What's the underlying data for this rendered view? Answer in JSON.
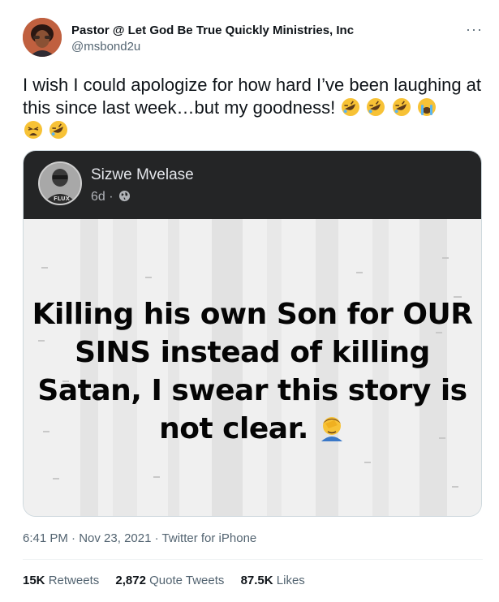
{
  "author": {
    "display_name": "Pastor @ Let God Be True Quickly Ministries, Inc",
    "handle": "@msbond2u",
    "avatar_icon": "profile-photo"
  },
  "more_icon": "more-options-icon",
  "tweet": {
    "text": "I wish I could apologize for how hard I’ve been laughing at this since last week…but my goodness!",
    "emojis": [
      "rolling-on-floor-laughing",
      "rolling-on-floor-laughing",
      "rolling-on-floor-laughing",
      "loudly-crying-face",
      "weary-face",
      "rolling-on-floor-laughing"
    ]
  },
  "embedded_post": {
    "poster_name": "Sizwe Mvelase",
    "age": "6d",
    "separator": "·",
    "visibility_icon": "globe-icon",
    "avatar_caption": "FLUX",
    "quote_text": "Killing his own Son for OUR SINS instead of killing Satan, I swear this story is not clear.",
    "quote_emoji": "person-facepalming",
    "header_color": "#242526",
    "background_color": "#f2f2f2"
  },
  "metadata": {
    "time": "6:41 PM",
    "date": "Nov 23, 2021",
    "source": "Twitter for iPhone",
    "dot": "·"
  },
  "stats": {
    "retweets_count": "15K",
    "retweets_label": "Retweets",
    "quote_count": "2,872",
    "quote_label": "Quote Tweets",
    "likes_count": "87.5K",
    "likes_label": "Likes"
  },
  "colors": {
    "text_primary": "#0f1419",
    "text_secondary": "#536471",
    "border": "#cfd9de",
    "emoji_yellow": "#f7c236"
  }
}
